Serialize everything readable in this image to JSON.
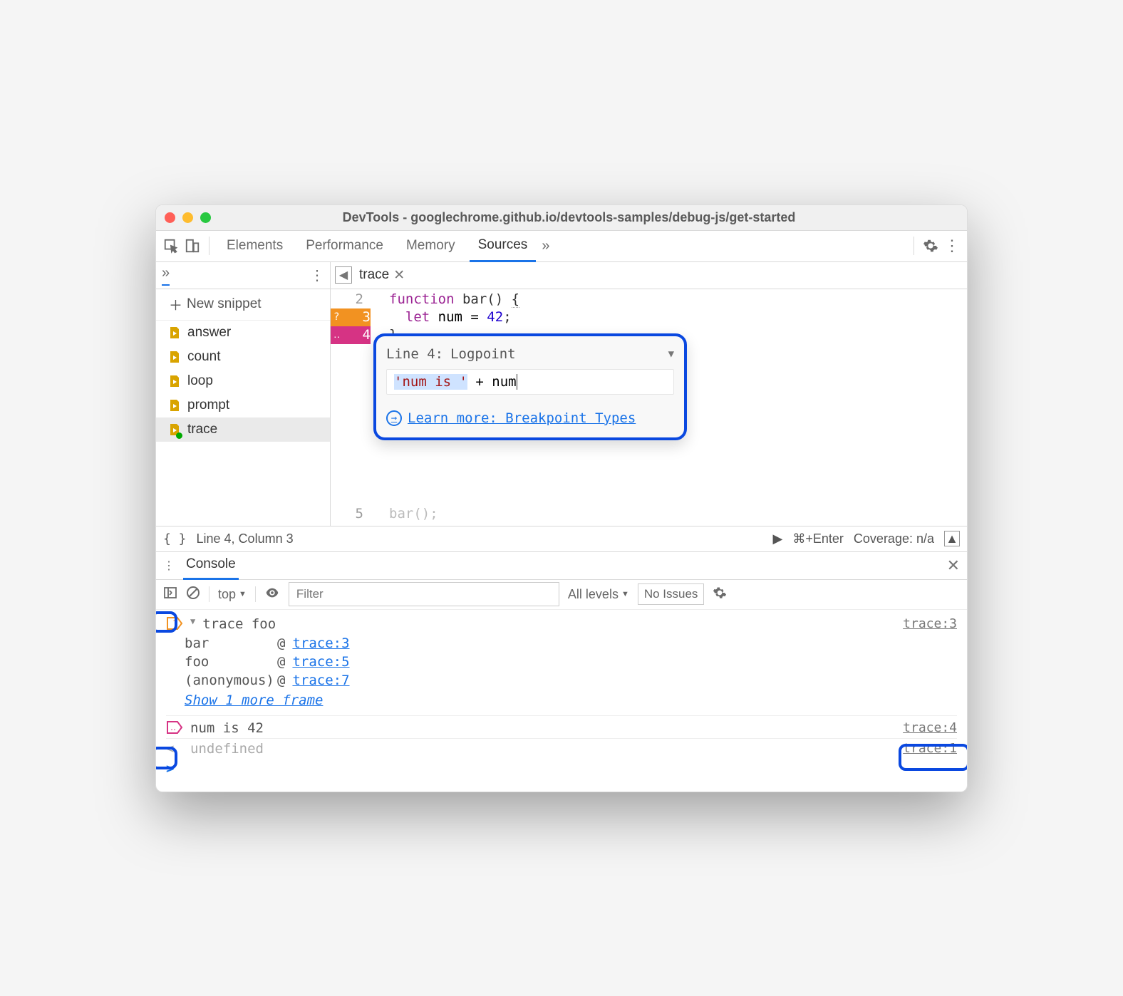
{
  "window": {
    "title": "DevTools - googlechrome.github.io/devtools-samples/debug-js/get-started"
  },
  "toolbar": {
    "tabs": [
      "Elements",
      "Performance",
      "Memory",
      "Sources"
    ],
    "active": "Sources",
    "more": "»"
  },
  "sidebar": {
    "new_snippet": "New snippet",
    "more": "»",
    "items": [
      {
        "name": "answer"
      },
      {
        "name": "count"
      },
      {
        "name": "loop"
      },
      {
        "name": "prompt"
      },
      {
        "name": "trace",
        "selected": true,
        "modified": true
      }
    ]
  },
  "editor": {
    "tab_name": "trace",
    "lines": [
      {
        "n": 2,
        "text": "function bar() {"
      },
      {
        "n": 3,
        "text": "  let num = 42;",
        "bp": "orange",
        "bp_sym": "?"
      },
      {
        "n": 4,
        "text": "}",
        "bp": "pink",
        "bp_sym": "‥"
      },
      {
        "n": 5,
        "text": "bar();"
      }
    ],
    "popover": {
      "line_label": "Line 4:",
      "type": "Logpoint",
      "expression_str": "'num is '",
      "expression_rest": " + num",
      "learn_more": "Learn more: Breakpoint Types"
    }
  },
  "status": {
    "position": "Line 4, Column 3",
    "run_hint": "⌘+Enter",
    "coverage": "Coverage: n/a"
  },
  "drawer": {
    "tab": "Console"
  },
  "console_toolbar": {
    "context": "top",
    "filter_placeholder": "Filter",
    "levels": "All levels",
    "issues": "No Issues"
  },
  "console": {
    "trace_label": "trace foo",
    "trace_src": "trace:3",
    "stack": [
      {
        "fn": "bar",
        "link": "trace:3"
      },
      {
        "fn": "foo",
        "link": "trace:5"
      },
      {
        "fn": "(anonymous)",
        "link": "trace:7"
      }
    ],
    "show_more": "Show 1 more frame",
    "log_msg": "num is 42",
    "log_src": "trace:4",
    "undef_msg": "undefined",
    "undef_src": "trace:1"
  }
}
